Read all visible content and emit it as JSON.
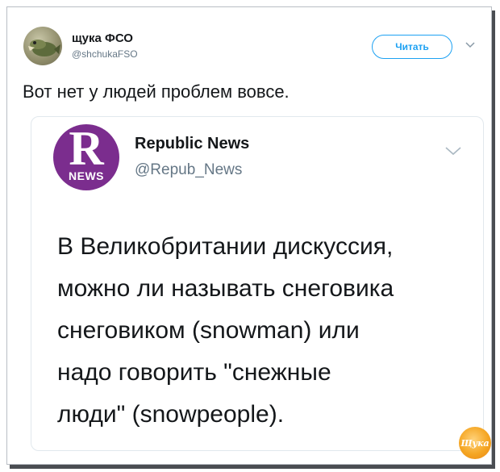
{
  "tweet": {
    "author_name": "щука ФСО",
    "author_handle": "@shchukaFSO",
    "follow_label": "Читать",
    "text": "Вот нет у людей проблем вовсе."
  },
  "quoted_tweet": {
    "logo_letter": "R",
    "logo_label": "NEWS",
    "author_name": "Republic News",
    "author_handle": "@Repub_News",
    "text_lines": [
      "В Великобритании дискуссия,",
      "можно ли называть снеговика",
      "снеговиком (snowman) или",
      "надо говорить \"снежные",
      "люди\" (snowpeople)."
    ]
  },
  "watermark": {
    "text": "Щука"
  },
  "colors": {
    "accent": "#1da1f2",
    "logo_bg": "#7b2d8e",
    "handle": "#657786"
  },
  "icons": [
    "avatar-pike",
    "chevron-down-icon",
    "watermark-logo"
  ]
}
